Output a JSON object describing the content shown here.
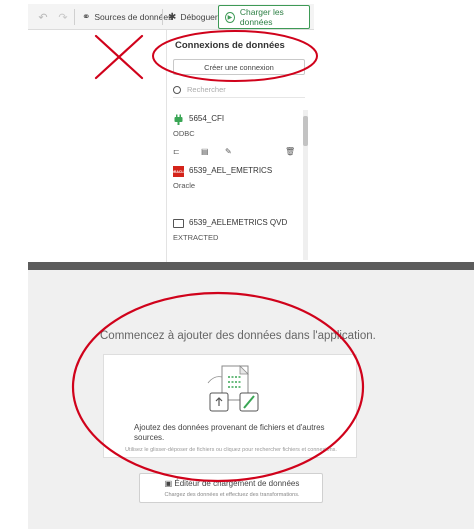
{
  "toolbar": {
    "undo_icon": "undo-icon",
    "redo_icon": "redo-icon",
    "sources_label": "Sources de données",
    "debug_label": "Déboguer",
    "load_label": "Charger les données"
  },
  "connections_panel": {
    "title": "Connexions de données",
    "create_button": "Créer une connexion",
    "search_placeholder": "Rechercher",
    "items": [
      {
        "name": "5654_CFI",
        "type": "ODBC",
        "icon": "plug-icon"
      },
      {
        "name": "6539_AEL_EMETRICS",
        "type": "Oracle",
        "icon": "oracle-logo",
        "logo_text": "ORACLE"
      },
      {
        "name": "6539_AELEMETRICS QVD",
        "type": "EXTRACTED",
        "icon": "folder-icon"
      }
    ]
  },
  "empty_state": {
    "headline": "Commencez à ajouter des données dans l'application.",
    "card_title": "Ajoutez des données provenant de fichiers et d'autres sources.",
    "card_subtitle": "Utilisez le glisser-déposer de fichiers ou cliquez pour rechercher fichiers et connexions.",
    "editor_title": "Éditeur de chargement de données",
    "editor_subtitle": "Chargez des données et effectuez des transformations."
  },
  "annotation_colors": {
    "red": "#d0021b",
    "accent_green": "#3e9a56"
  }
}
